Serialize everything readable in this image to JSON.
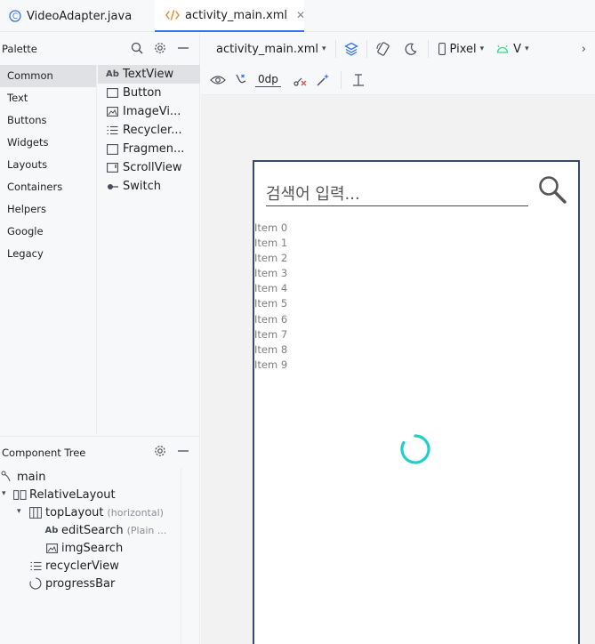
{
  "tabs": [
    {
      "label": "VideoAdapter.java",
      "icon": "java-class-icon",
      "active": false
    },
    {
      "label": "activity_main.xml",
      "icon": "xml-file-icon",
      "active": true
    }
  ],
  "palette": {
    "title": "Palette",
    "categories": [
      "Common",
      "Text",
      "Buttons",
      "Widgets",
      "Layouts",
      "Containers",
      "Helpers",
      "Google",
      "Legacy"
    ],
    "items": [
      {
        "label": "TextView",
        "icon": "textview-icon"
      },
      {
        "label": "Button",
        "icon": "button-icon"
      },
      {
        "label": "ImageVi...",
        "icon": "imageview-icon"
      },
      {
        "label": "Recycler...",
        "icon": "recyclerview-icon"
      },
      {
        "label": "Fragmen...",
        "icon": "fragment-icon"
      },
      {
        "label": "ScrollView",
        "icon": "scrollview-icon"
      },
      {
        "label": "Switch",
        "icon": "switch-icon"
      }
    ]
  },
  "component_tree": {
    "title": "Component Tree",
    "nodes": [
      {
        "label": "main",
        "sub": ""
      },
      {
        "label": "RelativeLayout",
        "sub": ""
      },
      {
        "label": "topLayout",
        "sub": "(horizontal)"
      },
      {
        "label": "editSearch",
        "sub": "(Plain ..."
      },
      {
        "label": "imgSearch",
        "sub": ""
      },
      {
        "label": "recyclerView",
        "sub": ""
      },
      {
        "label": "progressBar",
        "sub": ""
      }
    ]
  },
  "toolbar": {
    "file": "activity_main.xml",
    "device": "Pixel",
    "api": "V",
    "margin": "0dp"
  },
  "preview": {
    "search_hint": "검색어 입력...",
    "list_items": [
      "Item 0",
      "Item 1",
      "Item 2",
      "Item 3",
      "Item 4",
      "Item 5",
      "Item 6",
      "Item 7",
      "Item 8",
      "Item 9"
    ]
  },
  "colors": {
    "accent": "#3574f0",
    "spinner": "#1dcfc7",
    "android_green": "#3ddc84"
  }
}
